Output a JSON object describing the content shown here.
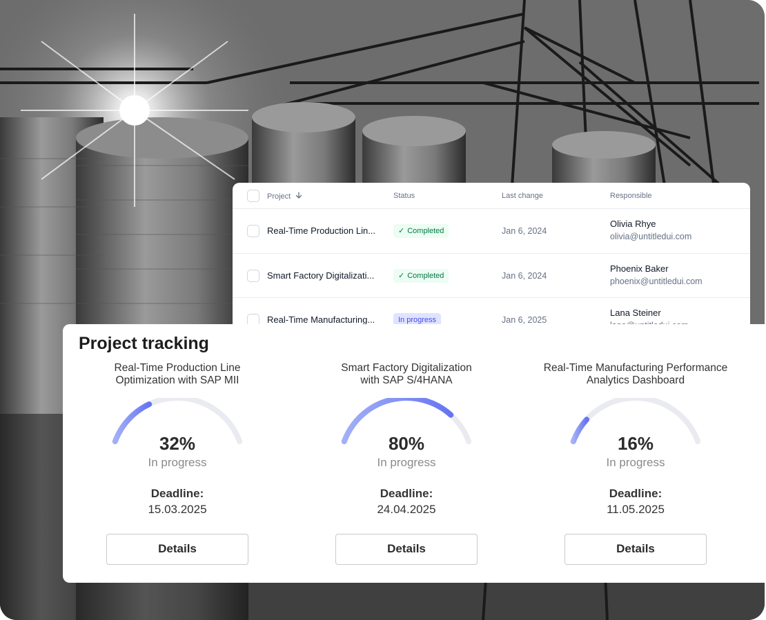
{
  "photo": {
    "icon": "industrial-grain-silos-photo"
  },
  "table": {
    "headers": {
      "project": "Project",
      "status": "Status",
      "last_change": "Last change",
      "responsible": "Responsible"
    },
    "sort_icon": "arrow-down-icon",
    "rows": [
      {
        "project": "Real-Time Production Lin...",
        "status": "Completed",
        "status_type": "completed",
        "date": "Jan 6, 2024",
        "name": "Olivia Rhye",
        "email": "olivia@untitledui.com"
      },
      {
        "project": "Smart Factory Digitalizati...",
        "status": "Completed",
        "status_type": "completed",
        "date": "Jan 6, 2024",
        "name": "Phoenix Baker",
        "email": "phoenix@untitledui.com"
      },
      {
        "project": "Real-Time Manufacturing...",
        "status": "In progress",
        "status_type": "in-progress",
        "date": "Jan 6, 2025",
        "name": "Lana Steiner",
        "email": "lana@untitledui.com"
      }
    ]
  },
  "tracking": {
    "title": "Project tracking",
    "projects": [
      {
        "name_line1": "Real-Time Production Line",
        "name_line2": "Optimization with SAP MII",
        "percent": 32,
        "percent_label": "32%",
        "status": "In progress",
        "deadline_label": "Deadline:",
        "deadline": "15.03.2025",
        "button": "Details"
      },
      {
        "name_line1": "Smart Factory Digitalization",
        "name_line2": "with SAP S/4HANA",
        "percent": 80,
        "percent_label": "80%",
        "status": "In progress",
        "deadline_label": "Deadline:",
        "deadline": "24.04.2025",
        "button": "Details"
      },
      {
        "name_line1": "Real-Time Manufacturing Performance",
        "name_line2": "Analytics Dashboard",
        "percent": 16,
        "percent_label": "16%",
        "status": "In progress",
        "deadline_label": "Deadline:",
        "deadline": "11.05.2025",
        "button": "Details"
      }
    ]
  },
  "colors": {
    "gauge_track": "#e9ebf0",
    "gauge_start": "#a3b0f7",
    "gauge_end": "#6574f2",
    "badge_done_bg": "#ecfdf3",
    "badge_done_text": "#067647",
    "badge_prog_bg": "#e0e3ff",
    "badge_prog_text": "#444ce7"
  }
}
